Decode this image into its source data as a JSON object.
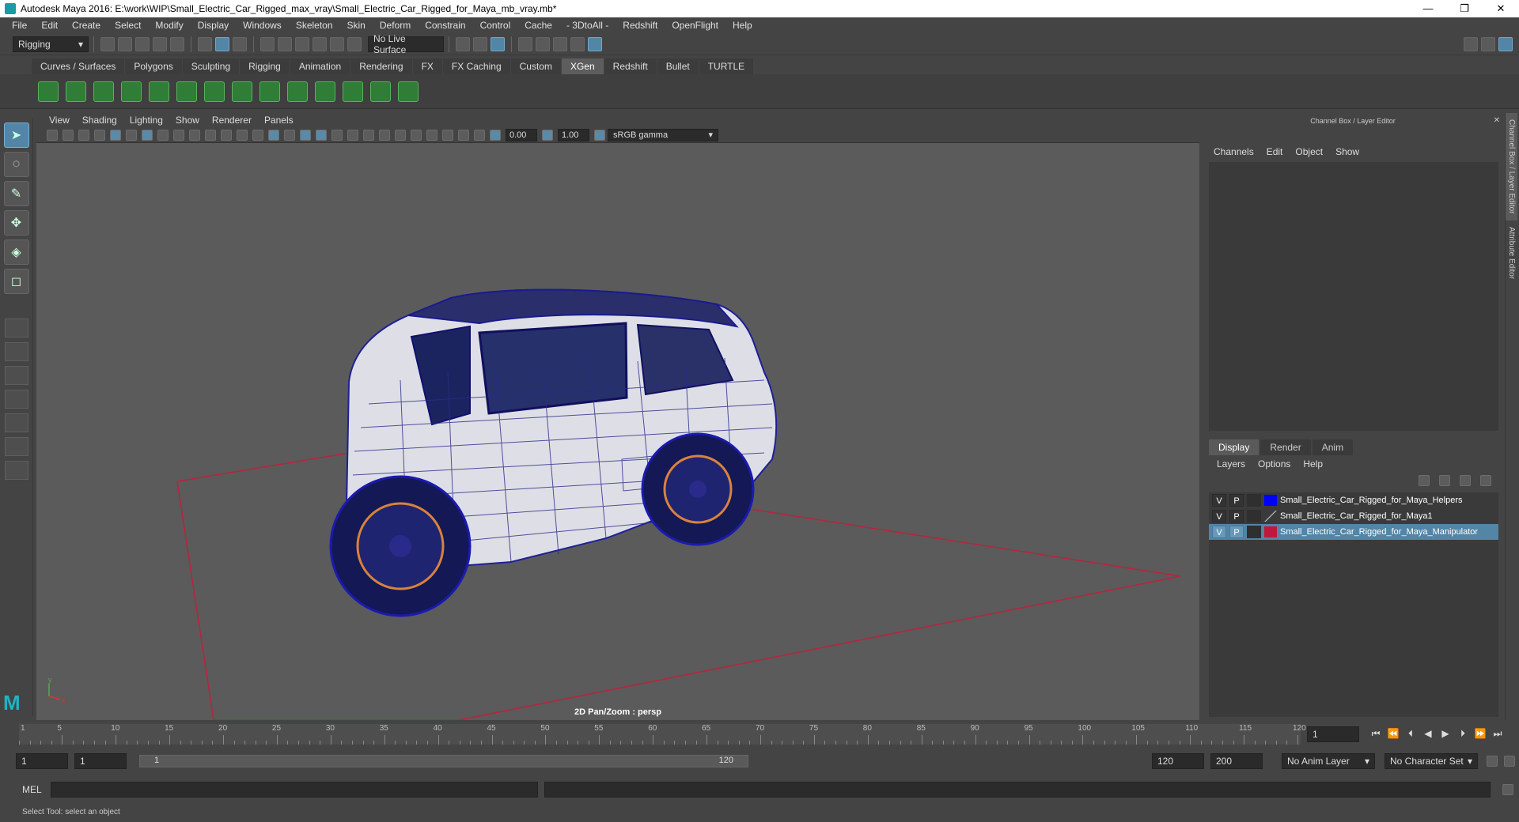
{
  "window": {
    "title": "Autodesk Maya 2016: E:\\work\\WIP\\Small_Electric_Car_Rigged_max_vray\\Small_Electric_Car_Rigged_for_Maya_mb_vray.mb*",
    "minimize": "—",
    "restore": "❐",
    "close": "✕"
  },
  "menus": [
    "File",
    "Edit",
    "Create",
    "Select",
    "Modify",
    "Display",
    "Windows",
    "Skeleton",
    "Skin",
    "Deform",
    "Constrain",
    "Control",
    "Cache",
    "- 3DtoAll -",
    "Redshift",
    "OpenFlight",
    "Help"
  ],
  "toolbar": {
    "mode": "Rigging",
    "live_surface": "No Live Surface"
  },
  "shelf_tabs": [
    "Curves / Surfaces",
    "Polygons",
    "Sculpting",
    "Rigging",
    "Animation",
    "Rendering",
    "FX",
    "FX Caching",
    "Custom",
    "XGen",
    "Redshift",
    "Bullet",
    "TURTLE"
  ],
  "shelf_active": "XGen",
  "viewport": {
    "menu": [
      "View",
      "Shading",
      "Lighting",
      "Show",
      "Renderer",
      "Panels"
    ],
    "exposure": "0.00",
    "gamma": "1.00",
    "color_space": "sRGB gamma",
    "camera_label": "2D Pan/Zoom : persp",
    "axis_y": "y",
    "axis_x": "x"
  },
  "channel_box": {
    "header": "Channel Box / Layer Editor",
    "menu": [
      "Channels",
      "Edit",
      "Object",
      "Show"
    ]
  },
  "layer_editor": {
    "tabs": [
      "Display",
      "Render",
      "Anim"
    ],
    "menu": [
      "Layers",
      "Options",
      "Help"
    ],
    "layers": [
      {
        "v": "V",
        "p": "P",
        "name": "Small_Electric_Car_Rigged_for_Maya_Helpers",
        "color": "#0000ff"
      },
      {
        "v": "V",
        "p": "P",
        "name": "Small_Electric_Car_Rigged_for_Maya1",
        "color": ""
      },
      {
        "v": "V",
        "p": "P",
        "name": "Small_Electric_Car_Rigged_for_Maya_Manipulator",
        "color": "#c0183c"
      }
    ]
  },
  "side_tabs": [
    "Channel Box / Layer Editor",
    "Attribute Editor"
  ],
  "timeline": {
    "ticks": [
      "5",
      "10",
      "15",
      "20",
      "25",
      "30",
      "35",
      "40",
      "45",
      "50",
      "55",
      "60",
      "65",
      "70",
      "75",
      "80",
      "85",
      "90",
      "95",
      "100",
      "105",
      "110",
      "115",
      "120"
    ],
    "start_label": "1",
    "current_frame": "1"
  },
  "range": {
    "start": "1",
    "current": "1",
    "slider_start": "1",
    "slider_end": "120",
    "end": "120",
    "max": "200",
    "anim_layer": "No Anim Layer",
    "char_set": "No Character Set"
  },
  "command_line": {
    "label": "MEL"
  },
  "status": {
    "help": "Select Tool: select an object"
  }
}
